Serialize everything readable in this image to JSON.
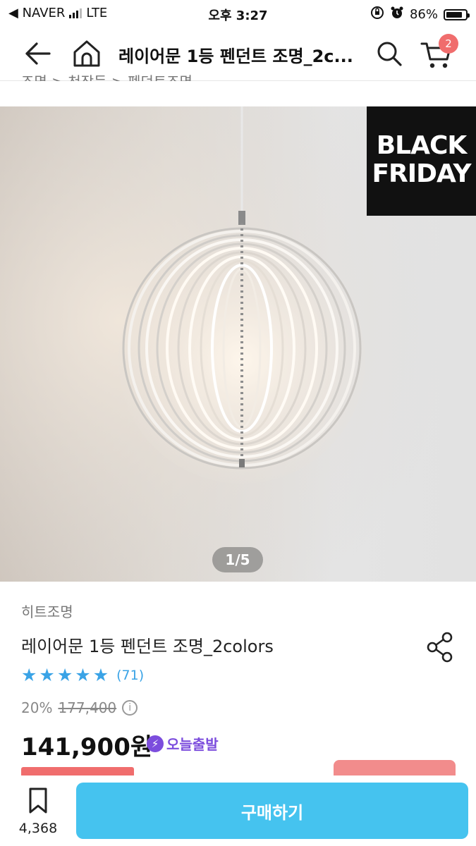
{
  "status_bar": {
    "carrier": "◀ NAVER",
    "network": "LTE",
    "time": "오후 3:27",
    "battery": "86%",
    "battery_level": 0.86
  },
  "nav": {
    "title": "레이어문 1등 펜던트 조명_2c...",
    "cart_count": "2",
    "icons": [
      "back-arrow-icon",
      "home-icon",
      "search-icon",
      "cart-icon"
    ]
  },
  "breadcrumb": "조명 > 천장등 > 펜던트조명",
  "hero": {
    "badge_line1": "BLACK",
    "badge_line2": "FRIDAY",
    "pager": "1/5"
  },
  "product": {
    "brand": "히트조명",
    "name": "레이어문 1등 펜던트 조명_2colors",
    "rating_stars": 5,
    "review_count": "(71)",
    "discount": "20%",
    "original_price": "177,400",
    "price": "141,900원",
    "delivery_tag": "오늘출발"
  },
  "bottom_bar": {
    "bookmark_count": "4,368",
    "buy_label": "구매하기"
  },
  "colors": {
    "accent_blue": "#45c3ef",
    "star_blue": "#3aa3e6",
    "badge_red": "#f06d6d",
    "today_purple": "#7c4ddd"
  }
}
